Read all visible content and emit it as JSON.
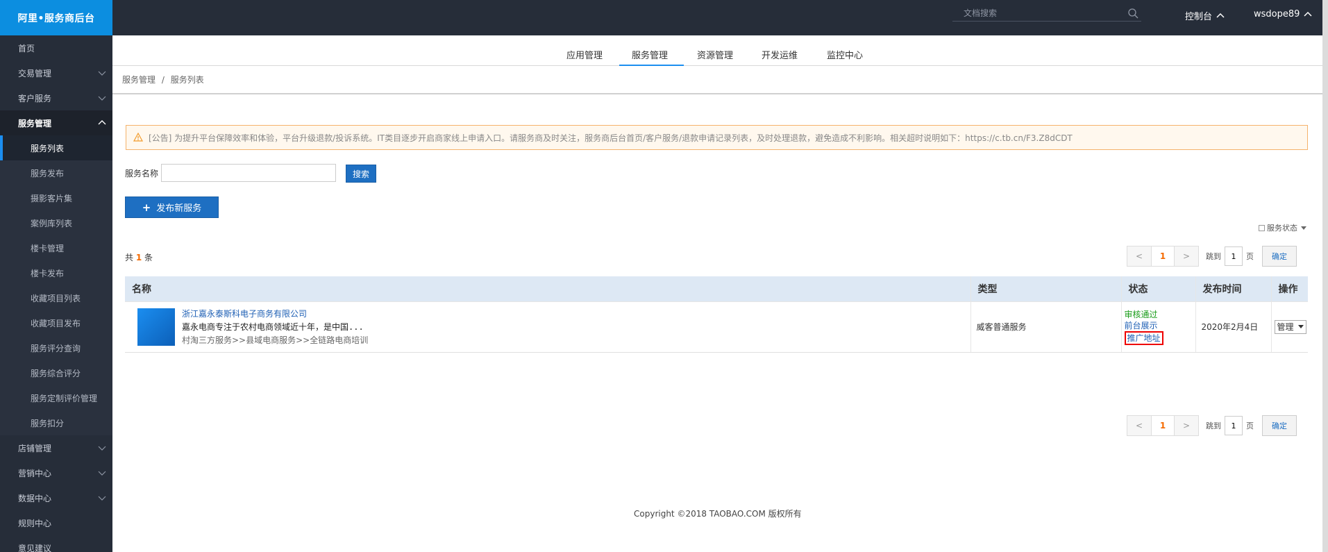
{
  "brand": "阿里•服务商后台",
  "sidebar": {
    "items": [
      {
        "label": "首页",
        "chevron": ""
      },
      {
        "label": "交易管理",
        "chevron": "down"
      },
      {
        "label": "客户服务",
        "chevron": "down"
      },
      {
        "label": "服务管理",
        "chevron": "up"
      }
    ],
    "sub_items": [
      "服务列表",
      "服务发布",
      "摄影客片集",
      "案例库列表",
      "楼卡管理",
      "楼卡发布",
      "收藏项目列表",
      "收藏项目发布",
      "服务评分查询",
      "服务综合评分",
      "服务定制评价管理",
      "服务扣分"
    ],
    "bottom_items": [
      {
        "label": "店铺管理",
        "chevron": "down"
      },
      {
        "label": "营销中心",
        "chevron": "down"
      },
      {
        "label": "数据中心",
        "chevron": "down"
      },
      {
        "label": "规则中心",
        "chevron": ""
      },
      {
        "label": "意见建议",
        "chevron": ""
      }
    ]
  },
  "header": {
    "search_placeholder": "文档搜索",
    "console_label": "控制台",
    "user_label": "wsdope89"
  },
  "module_tabs": [
    "应用管理",
    "服务管理",
    "资源管理",
    "开发运维",
    "监控中心"
  ],
  "breadcrumb": {
    "parent": "服务管理",
    "separator": "/",
    "current": "服务列表"
  },
  "notice": "[公告] 为提升平台保障效率和体验，平台升级退款/投诉系统。IT类目逐步开启商家线上申请入口。请服务商及时关注，服务商后台首页/客户服务/退款申请记录列表，及时处理退款，避免造成不利影响。相关超时说明如下：https://c.tb.cn/F3.Z8dCDT",
  "search_form": {
    "label": "服务名称",
    "value": "",
    "search_button": "搜索"
  },
  "publish_button": "发布新服务",
  "status_filter": "服务状态",
  "total": {
    "prefix": "共",
    "count": "1",
    "suffix": "条"
  },
  "pagination": {
    "prev": "<",
    "current": "1",
    "next": ">",
    "jump_label": "跳到",
    "page_value": "1",
    "page_suffix": "页",
    "confirm": "确定"
  },
  "table": {
    "headers": [
      "名称",
      "类型",
      "状态",
      "发布时间",
      "操作"
    ],
    "rows": [
      {
        "title": "浙江嘉永泰斯科电子商务有限公司",
        "desc": "嘉永电商专注于农村电商领域近十年，是中国...",
        "category": "村淘三方服务>>县域电商服务>>全链路电商培训",
        "type": "威客普通服务",
        "status_approved": "审核通过",
        "status_front": "前台展示",
        "status_promo": "推广地址",
        "publish_date": "2020年2月4日",
        "action": "管理"
      }
    ]
  },
  "copyright": "Copyright ©2018 TAOBAO.COM 版权所有"
}
